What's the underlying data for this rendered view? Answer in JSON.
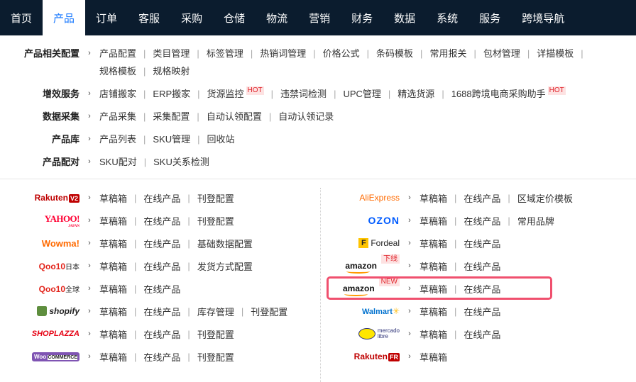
{
  "nav": {
    "items": [
      "首页",
      "产品",
      "订单",
      "客服",
      "采购",
      "仓储",
      "物流",
      "营销",
      "财务",
      "数据",
      "系统",
      "服务",
      "跨境导航"
    ],
    "active": "产品"
  },
  "config": {
    "rows": [
      {
        "label": "产品相关配置",
        "links": [
          "产品配置",
          "类目管理",
          "标签管理",
          "热销词管理",
          "价格公式",
          "条码模板",
          "常用报关",
          "包材管理",
          "详描模板",
          "规格模板",
          "规格映射"
        ]
      },
      {
        "label": "增效服务",
        "links": [
          "店铺搬家",
          "ERP搬家",
          "货源监控",
          "违禁词检测",
          "UPC管理",
          "精选货源",
          "1688跨境电商采购助手"
        ],
        "hot_on": [
          "货源监控",
          "1688跨境电商采购助手"
        ],
        "hot_text": "HOT"
      },
      {
        "label": "数据采集",
        "links": [
          "产品采集",
          "采集配置",
          "自动认领配置",
          "自动认领记录"
        ]
      },
      {
        "label": "产品库",
        "links": [
          "产品列表",
          "SKU管理",
          "回收站"
        ]
      },
      {
        "label": "产品配对",
        "links": [
          "SKU配对",
          "SKU关系检测"
        ]
      }
    ]
  },
  "platforms": {
    "left": [
      {
        "name": "Rakuten V2",
        "logo_text": "Rakuten",
        "logo_badge": "V2",
        "links": [
          "草稿箱",
          "在线产品",
          "刊登配置"
        ]
      },
      {
        "name": "Yahoo Japan",
        "logo_text": "YAHOO!",
        "logo_sub": "JAPAN",
        "links": [
          "草稿箱",
          "在线产品",
          "刊登配置"
        ]
      },
      {
        "name": "Wowma",
        "logo_text": "Wowma!",
        "links": [
          "草稿箱",
          "在线产品",
          "基础数据配置"
        ]
      },
      {
        "name": "Qoo10日本",
        "logo_text": "Qoo10",
        "logo_sub": "日本",
        "links": [
          "草稿箱",
          "在线产品",
          "发货方式配置"
        ]
      },
      {
        "name": "Qoo10全球",
        "logo_text": "Qoo10",
        "logo_sub": "全球",
        "links": [
          "草稿箱",
          "在线产品"
        ]
      },
      {
        "name": "Shopify",
        "logo_text": "shopify",
        "links": [
          "草稿箱",
          "在线产品",
          "库存管理",
          "刊登配置"
        ]
      },
      {
        "name": "Shoplazza",
        "logo_text": "SHOPLAZZA",
        "links": [
          "草稿箱",
          "在线产品",
          "刊登配置"
        ]
      },
      {
        "name": "WooCommerce",
        "logo_text": "Woo",
        "logo_sub": "COMMERCE",
        "links": [
          "草稿箱",
          "在线产品",
          "刊登配置"
        ]
      }
    ],
    "right": [
      {
        "name": "AliExpress",
        "logo_text": "AliExpress",
        "links": [
          "草稿箱",
          "在线产品",
          "区域定价模板"
        ]
      },
      {
        "name": "Ozon",
        "logo_text": "OZON",
        "links": [
          "草稿箱",
          "在线产品",
          "常用品牌"
        ]
      },
      {
        "name": "Fordeal",
        "logo_text": "Fordeal",
        "logo_badge": "F",
        "links": [
          "草稿箱",
          "在线产品"
        ]
      },
      {
        "name": "Amazon 下线",
        "logo_text": "amazon",
        "tag": "下线",
        "links": [
          "草稿箱",
          "在线产品"
        ]
      },
      {
        "name": "Amazon NEW",
        "logo_text": "amazon",
        "tag": "NEW",
        "links": [
          "草稿箱",
          "在线产品"
        ],
        "highlighted": true
      },
      {
        "name": "Walmart",
        "logo_text": "Walmart",
        "links": [
          "草稿箱",
          "在线产品"
        ]
      },
      {
        "name": "Mercado Libre",
        "logo_text": "mercado",
        "logo_sub": "libre",
        "links": [
          "草稿箱",
          "在线产品"
        ]
      },
      {
        "name": "Rakuten FR",
        "logo_text": "Rakuten",
        "logo_badge": "FR",
        "links": [
          "草稿箱"
        ]
      }
    ]
  },
  "colors": {
    "nav_bg": "#0b1c2e",
    "accent": "#1677ff",
    "hot": "#e0242b",
    "highlight": "#f0506e"
  }
}
